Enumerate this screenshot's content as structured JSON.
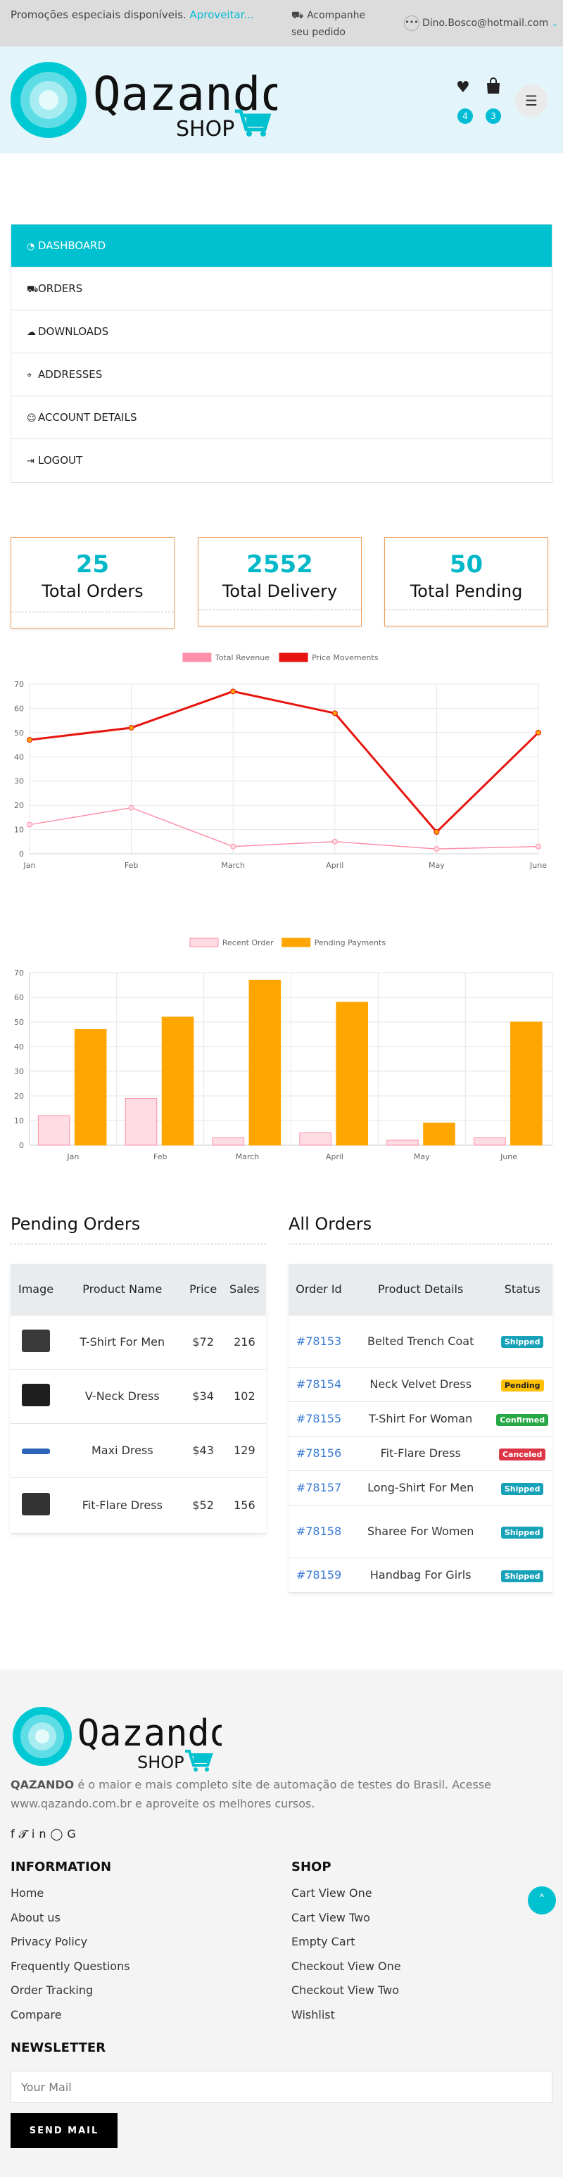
{
  "topbar": {
    "promo_text": "Promoções especiais disponíveis.",
    "promo_link": "Aproveitar...",
    "track_label": "Acompanhe seu pedido",
    "account_email": "Dino.Bosco@hotmail.com"
  },
  "header": {
    "logo_text": "Qazando",
    "logo_sub": "SHOP",
    "wishlist_count": "4",
    "cart_count": "3"
  },
  "dashboard_menu": [
    {
      "icon": "dashboard-icon",
      "label": "DASHBOARD",
      "active": true
    },
    {
      "icon": "cart-icon",
      "label": "ORDERS"
    },
    {
      "icon": "cloud-download-icon",
      "label": "DOWNLOADS"
    },
    {
      "icon": "map-marker-icon",
      "label": "ADDRESSES"
    },
    {
      "icon": "user-icon",
      "label": "ACCOUNT DETAILS"
    },
    {
      "icon": "logout-icon",
      "label": "LOGOUT"
    }
  ],
  "stats": [
    {
      "value": "25",
      "label": "Total Orders"
    },
    {
      "value": "2552",
      "label": "Total Delivery"
    },
    {
      "value": "50",
      "label": "Total Pending"
    }
  ],
  "chart_data": [
    {
      "type": "line",
      "categories": [
        "Jan",
        "Feb",
        "March",
        "April",
        "May",
        "June"
      ],
      "series": [
        {
          "name": "Total Revenue",
          "values": [
            12,
            19,
            3,
            5,
            2,
            3
          ],
          "color": "#ff8fa8"
        },
        {
          "name": "Price Movements",
          "values": [
            47,
            52,
            67,
            58,
            9,
            50
          ],
          "color": "#e8140f"
        }
      ],
      "ylim": [
        0,
        70
      ],
      "yticks": [
        0,
        10,
        20,
        30,
        40,
        50,
        60,
        70
      ],
      "legend": "top-center",
      "grid": true
    },
    {
      "type": "bar",
      "categories": [
        "Jan",
        "Feb",
        "March",
        "April",
        "May",
        "June"
      ],
      "series": [
        {
          "name": "Recent Order",
          "values": [
            12,
            19,
            3,
            5,
            2,
            3
          ],
          "color": "#ffdbe4"
        },
        {
          "name": "Pending Payments",
          "values": [
            47,
            52,
            67,
            58,
            9,
            50
          ],
          "color": "#ffa500"
        }
      ],
      "ylim": [
        0,
        70
      ],
      "yticks": [
        0,
        10,
        20,
        30,
        40,
        50,
        60,
        70
      ],
      "legend": "top-center",
      "grid": true
    }
  ],
  "pending_orders": {
    "title": "Pending Orders",
    "headers": [
      "Image",
      "Product Name",
      "Price",
      "Sales"
    ],
    "rows": [
      {
        "image": "laptop",
        "name": "T-Shirt For Men",
        "price": "$72",
        "sales": "216"
      },
      {
        "image": "gamepad",
        "name": "V-Neck Dress",
        "price": "$34",
        "sales": "102"
      },
      {
        "image": "keyboard",
        "name": "Maxi Dress",
        "price": "$43",
        "sales": "129"
      },
      {
        "image": "console",
        "name": "Fit-Flare Dress",
        "price": "$52",
        "sales": "156"
      }
    ]
  },
  "all_orders": {
    "title": "All Orders",
    "headers": [
      "Order Id",
      "Product Details",
      "Status"
    ],
    "rows": [
      {
        "id": "#78153",
        "product": "Belted Trench Coat",
        "status": "Shipped",
        "color": "#17a2b8"
      },
      {
        "id": "#78154",
        "product": "Neck Velvet Dress",
        "status": "Pending",
        "color": "#ffc107"
      },
      {
        "id": "#78155",
        "product": "T-Shirt For Woman",
        "status": "Confirmed",
        "color": "#28a745"
      },
      {
        "id": "#78156",
        "product": "Fit-Flare Dress",
        "status": "Canceled",
        "color": "#dc3545"
      },
      {
        "id": "#78157",
        "product": "Long-Shirt For Men",
        "status": "Shipped",
        "color": "#17a2b8"
      },
      {
        "id": "#78158",
        "product": "Sharee For Women",
        "status": "Shipped",
        "color": "#17a2b8"
      },
      {
        "id": "#78159",
        "product": "Handbag For Girls",
        "status": "Shipped",
        "color": "#17a2b8"
      }
    ]
  },
  "footer": {
    "about_brand": "QAZANDO",
    "about_text": " é o maior e mais completo site de automação de testes do Brasil. Acesse www.qazando.com.br e aproveite os melhores cursos.",
    "info_title": "INFORMATION",
    "info_links": [
      "Home",
      "About us",
      "Privacy Policy",
      "Frequently Questions",
      "Order Tracking",
      "Compare"
    ],
    "shop_title": "SHOP",
    "shop_links": [
      "Cart View One",
      "Cart View Two",
      "Empty Cart",
      "Checkout View One",
      "Checkout View Two",
      "Wishlist"
    ],
    "newsletter_title": "NEWSLETTER",
    "mail_placeholder": "Your Mail",
    "send_label": "SEND MAIL"
  },
  "colors": {
    "accent": "#00c1cf",
    "orange": "#ffa500",
    "red": "#e8140f"
  }
}
